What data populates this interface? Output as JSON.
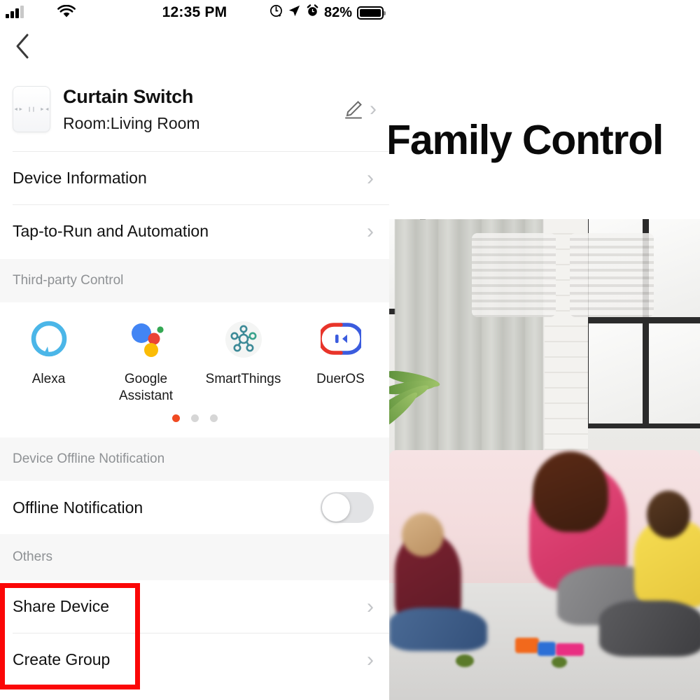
{
  "status_bar": {
    "signal_icon": "cellular-signal-icon",
    "wifi_icon": "wifi-icon",
    "time": "12:35 PM",
    "rotation_lock_icon": "rotation-lock-icon",
    "location_icon": "location-arrow-icon",
    "alarm_icon": "alarm-clock-icon",
    "battery_percent": "82%",
    "battery_icon": "battery-icon"
  },
  "nav": {
    "back_icon": "chevron-left-icon"
  },
  "device": {
    "icon_name": "curtain-switch-panel-icon",
    "button_open": "◄►",
    "button_pause": "❙❙",
    "button_close": "►◄",
    "title": "Curtain Switch",
    "room": "Room:Living Room",
    "edit_icon": "pencil-edit-icon",
    "chevron": "›"
  },
  "rows": [
    {
      "label": "Device Information",
      "chevron": "›"
    },
    {
      "label": "Tap-to-Run and Automation",
      "chevron": "›"
    }
  ],
  "third_party": {
    "section_title": "Third-party Control",
    "items": [
      {
        "label": "Alexa",
        "icon": "alexa-icon",
        "color": "#4bb6e8"
      },
      {
        "label": "Google Assistant",
        "icon": "google-assistant-icon",
        "color": "#4285f4"
      },
      {
        "label": "SmartThings",
        "icon": "smartthings-icon",
        "color": "#3d8a97"
      },
      {
        "label": "DuerOS",
        "icon": "dueros-icon",
        "color": "#3b5cde"
      }
    ],
    "pager": {
      "total": 3,
      "active_index": 0,
      "active_color": "#f04a22",
      "inactive_color": "#d6d6d6"
    }
  },
  "offline": {
    "section_title": "Device Offline Notification",
    "row_label": "Offline Notification",
    "toggle_state": "off"
  },
  "others": {
    "section_title": "Others",
    "rows": [
      {
        "label": "Share Device",
        "chevron": "›"
      },
      {
        "label": "Create Group",
        "chevron": "›"
      }
    ]
  },
  "annotation": {
    "highlight_color": "#fb0707",
    "name": "red-highlight-box"
  },
  "right_panel": {
    "headline": "Family Control",
    "photo_alt": "family-living-room-photo"
  }
}
